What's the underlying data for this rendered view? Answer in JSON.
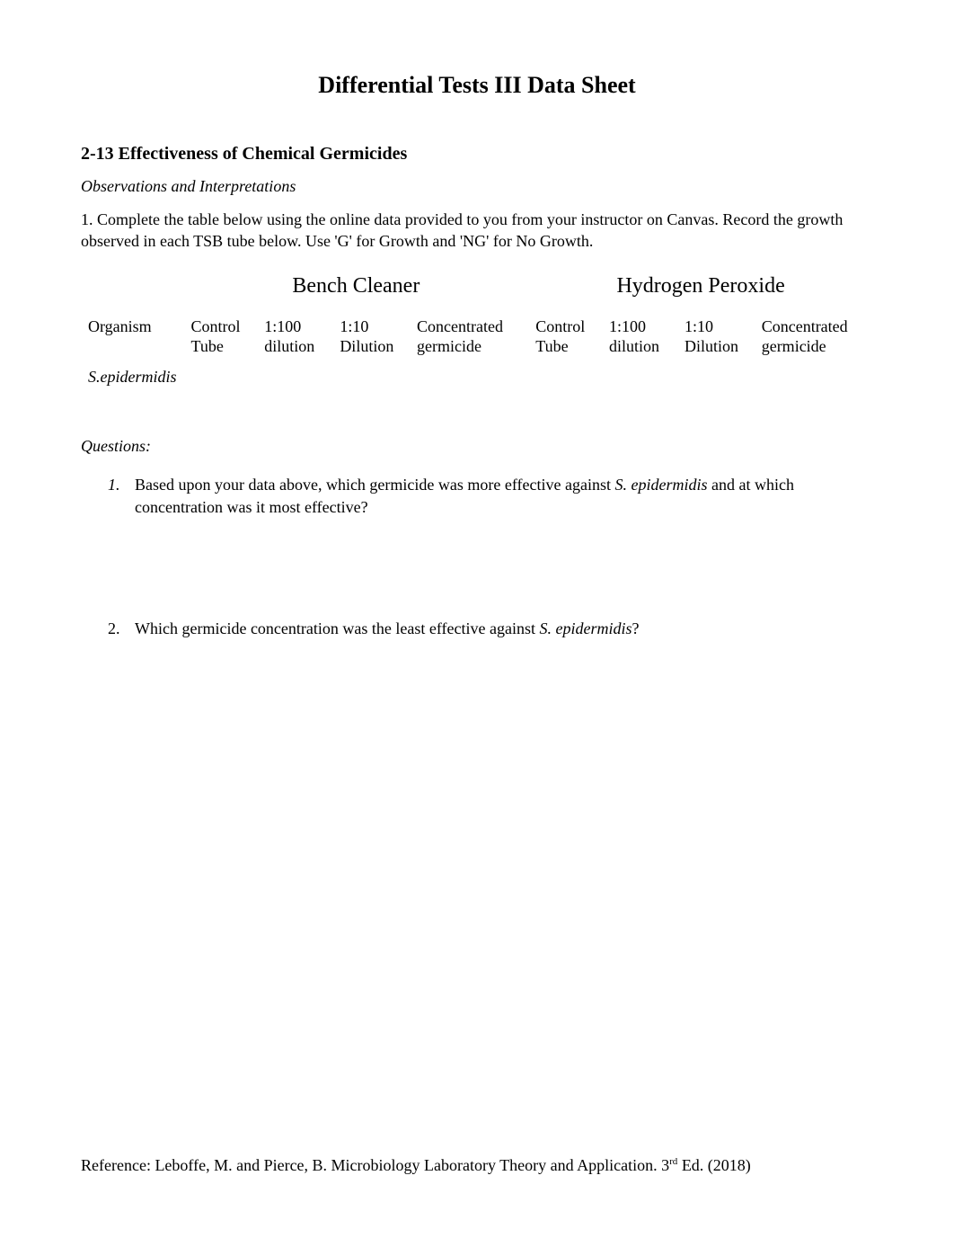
{
  "title": "Differential Tests III Data Sheet",
  "section": {
    "heading": "2-13 Effectiveness of Chemical Germicides",
    "subheading": "Observations and Interpretations",
    "instruction": "1. Complete the table below using the online data provided to you from your instructor on Canvas. Record the growth observed in each TSB tube below. Use 'G' for Growth and 'NG' for No Growth."
  },
  "table": {
    "group_a": "Bench Cleaner",
    "group_b": "Hydrogen Peroxide",
    "row_label": "Organism",
    "cols": {
      "a1": "Control Tube",
      "a2": "1:100 dilution",
      "a3": "1:10 Dilution",
      "a4": "Concentrated germicide",
      "b1": "Control Tube",
      "b2": "1:100 dilution",
      "b3": "1:10 Dilution",
      "b4": "Concentrated germicide"
    },
    "organism": "S.epidermidis",
    "cells": {
      "a1": "",
      "a2": "",
      "a3": "",
      "a4": "",
      "b1": "",
      "b2": "",
      "b3": "",
      "b4": ""
    }
  },
  "questions": {
    "label": "Questions:",
    "q1_marker": "1.",
    "q1_pre": "Based upon your data above, which germicide was more effective against ",
    "q1_ital": "S. epidermidis",
    "q1_post": " and at which concentration was it most effective?",
    "q2_marker": "2.",
    "q2_pre": "Which germicide concentration was the least effective against ",
    "q2_ital": "S. epidermidis",
    "q2_post": "?"
  },
  "footer": {
    "pre": "Reference: Leboffe, M. and Pierce, B. Microbiology Laboratory Theory and Application. 3",
    "sup": "rd",
    "post": " Ed. (2018)"
  }
}
